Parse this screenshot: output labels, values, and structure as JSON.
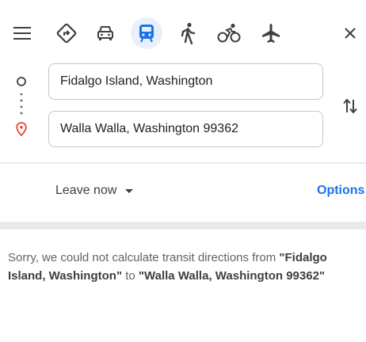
{
  "header": {
    "menu_icon": "hamburger-menu-icon",
    "close_icon": "close-icon",
    "modes": [
      {
        "name": "best-route",
        "icon": "directions-diamond-icon",
        "selected": false
      },
      {
        "name": "driving",
        "icon": "car-icon",
        "selected": false
      },
      {
        "name": "transit",
        "icon": "train-icon",
        "selected": true
      },
      {
        "name": "walking",
        "icon": "walking-icon",
        "selected": false
      },
      {
        "name": "cycling",
        "icon": "bicycle-icon",
        "selected": false
      },
      {
        "name": "flights",
        "icon": "airplane-icon",
        "selected": false
      }
    ]
  },
  "route": {
    "origin": "Fidalgo Island, Washington",
    "destination": "Walla Walla, Washington 99362"
  },
  "options_bar": {
    "leave_label": "Leave now",
    "options_label": "Options"
  },
  "message": {
    "prefix": "Sorry, we could not calculate transit directions from ",
    "origin": "\"Fidalgo Island, Washington\"",
    "connector": " to ",
    "destination": "\"Walla Walla, Washington 99362\""
  },
  "colors": {
    "accent": "#1a73e8",
    "selected_mode_bg": "#e8f0fe",
    "destination_pin": "#ea4335"
  }
}
